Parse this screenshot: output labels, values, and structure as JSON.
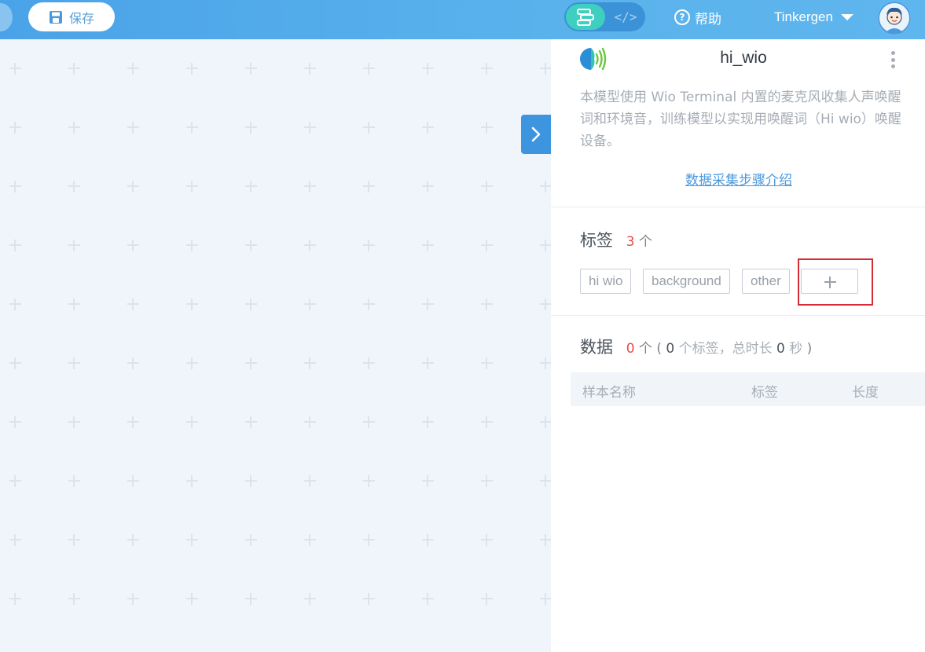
{
  "topbar": {
    "save_label": "保存",
    "mode_toggle": {
      "active": "blocks",
      "code_label": "</>"
    },
    "help_label": "帮助",
    "user_name": "Tinkergen"
  },
  "panel": {
    "model_title": "hi_wio",
    "description": "本模型使用 Wio Terminal 内置的麦克风收集人声唤醒词和环境音，训练模型以实现用唤醒词（Hi wio）唤醒设备。",
    "guide_link": "数据采集步骤介绍",
    "labels_section": {
      "title": "标签",
      "count": "3",
      "unit": "个",
      "tags": [
        "hi wio",
        "background",
        "other"
      ]
    },
    "data_section": {
      "title": "数据",
      "count": "0",
      "unit": "个",
      "paren_open": "(",
      "label_count": "0",
      "label_unit": "个标签，总时长",
      "duration": "0",
      "duration_unit": "秒",
      "paren_close": ")",
      "columns": [
        "样本名称",
        "标签",
        "长度"
      ]
    }
  },
  "colors": {
    "topbar": "#4aa3e8",
    "accent_blue": "#3d95e0",
    "count_red": "#e84a4a",
    "highlight": "#d62b34",
    "teal_active": "#3fcfc0"
  }
}
